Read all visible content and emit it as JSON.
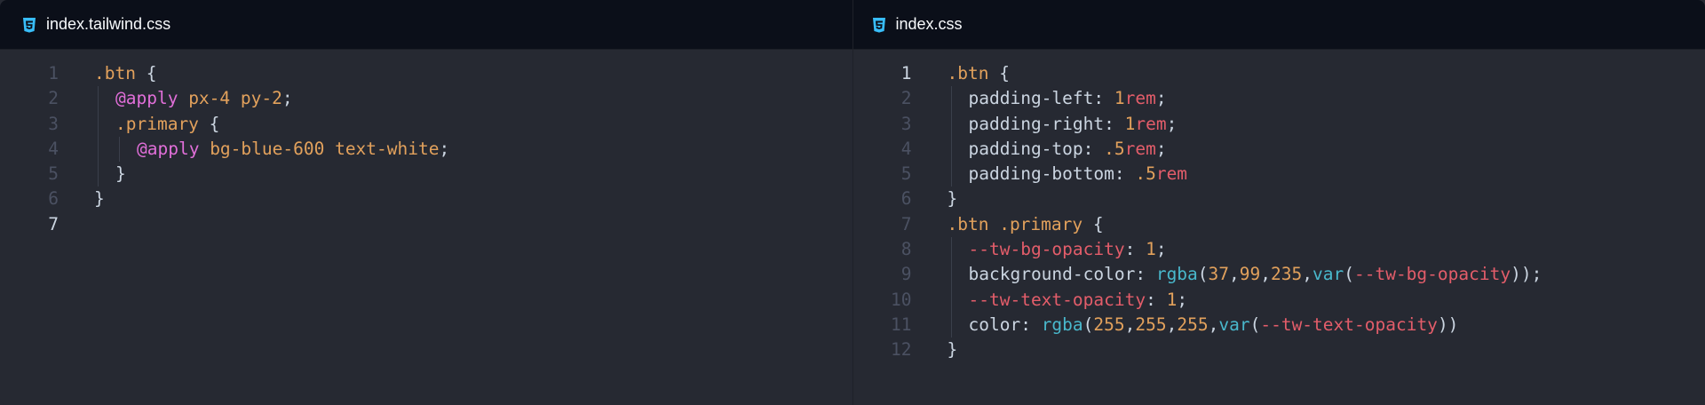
{
  "colors": {
    "background": "#262932",
    "tabbar": "#0b0f19",
    "selector": "#e2a15c",
    "at_rule": "#e16fd9",
    "unit": "#e35d6a",
    "function": "#49b8cc",
    "text": "#cbd5e1",
    "css_icon": "#38bdf8"
  },
  "left_pane": {
    "tab": {
      "icon": "css3-icon",
      "label": "index.tailwind.css"
    },
    "line_numbers": [
      "1",
      "2",
      "3",
      "4",
      "5",
      "6",
      "7"
    ],
    "code": {
      "l1_selector": ".btn",
      "l1_brace": " {",
      "l2_at": "@apply",
      "l2_classes": " px-4 py-2",
      "l2_end": ";",
      "l3_selector": ".primary",
      "l3_brace": " {",
      "l4_at": "@apply",
      "l4_classes": " bg-blue-600 text-white",
      "l4_end": ";",
      "l5_close": "}",
      "l6_close": "}"
    }
  },
  "right_pane": {
    "tab": {
      "icon": "css3-icon",
      "label": "index.css"
    },
    "line_numbers": [
      "1",
      "2",
      "3",
      "4",
      "5",
      "6",
      "7",
      "8",
      "9",
      "10",
      "11",
      "12"
    ],
    "code": {
      "l1_selector": ".btn",
      "l1_brace": " {",
      "l2_prop": "padding-left: ",
      "l2_num": "1",
      "l2_unit": "rem",
      "l2_end": ";",
      "l3_prop": "padding-right: ",
      "l3_num": "1",
      "l3_unit": "rem",
      "l3_end": ";",
      "l4_prop": "padding-top: ",
      "l4_num": ".5",
      "l4_unit": "rem",
      "l4_end": ";",
      "l5_prop": "padding-bottom: ",
      "l5_num": ".5",
      "l5_unit": "rem",
      "l6_close": "}",
      "l7_selector": ".btn .primary",
      "l7_brace": " {",
      "l8_var": "--tw-bg-opacity",
      "l8_colon": ": ",
      "l8_num": "1",
      "l8_end": ";",
      "l9_prop": "background-color: ",
      "l9_fn": "rgba",
      "l9_open": "(",
      "l9_n1": "37",
      "l9_c1": ",",
      "l9_n2": "99",
      "l9_c2": ",",
      "l9_n3": "235",
      "l9_c3": ",",
      "l9_fn2": "var",
      "l9_open2": "(",
      "l9_var": "--tw-bg-opacity",
      "l9_close": "));",
      "l10_var": "--tw-text-opacity",
      "l10_colon": ": ",
      "l10_num": "1",
      "l10_end": ";",
      "l11_prop": "color: ",
      "l11_fn": "rgba",
      "l11_open": "(",
      "l11_n1": "255",
      "l11_c1": ",",
      "l11_n2": "255",
      "l11_c2": ",",
      "l11_n3": "255",
      "l11_c3": ",",
      "l11_fn2": "var",
      "l11_open2": "(",
      "l11_var": "--tw-text-opacity",
      "l11_close": "))",
      "l12_close": "}"
    }
  }
}
